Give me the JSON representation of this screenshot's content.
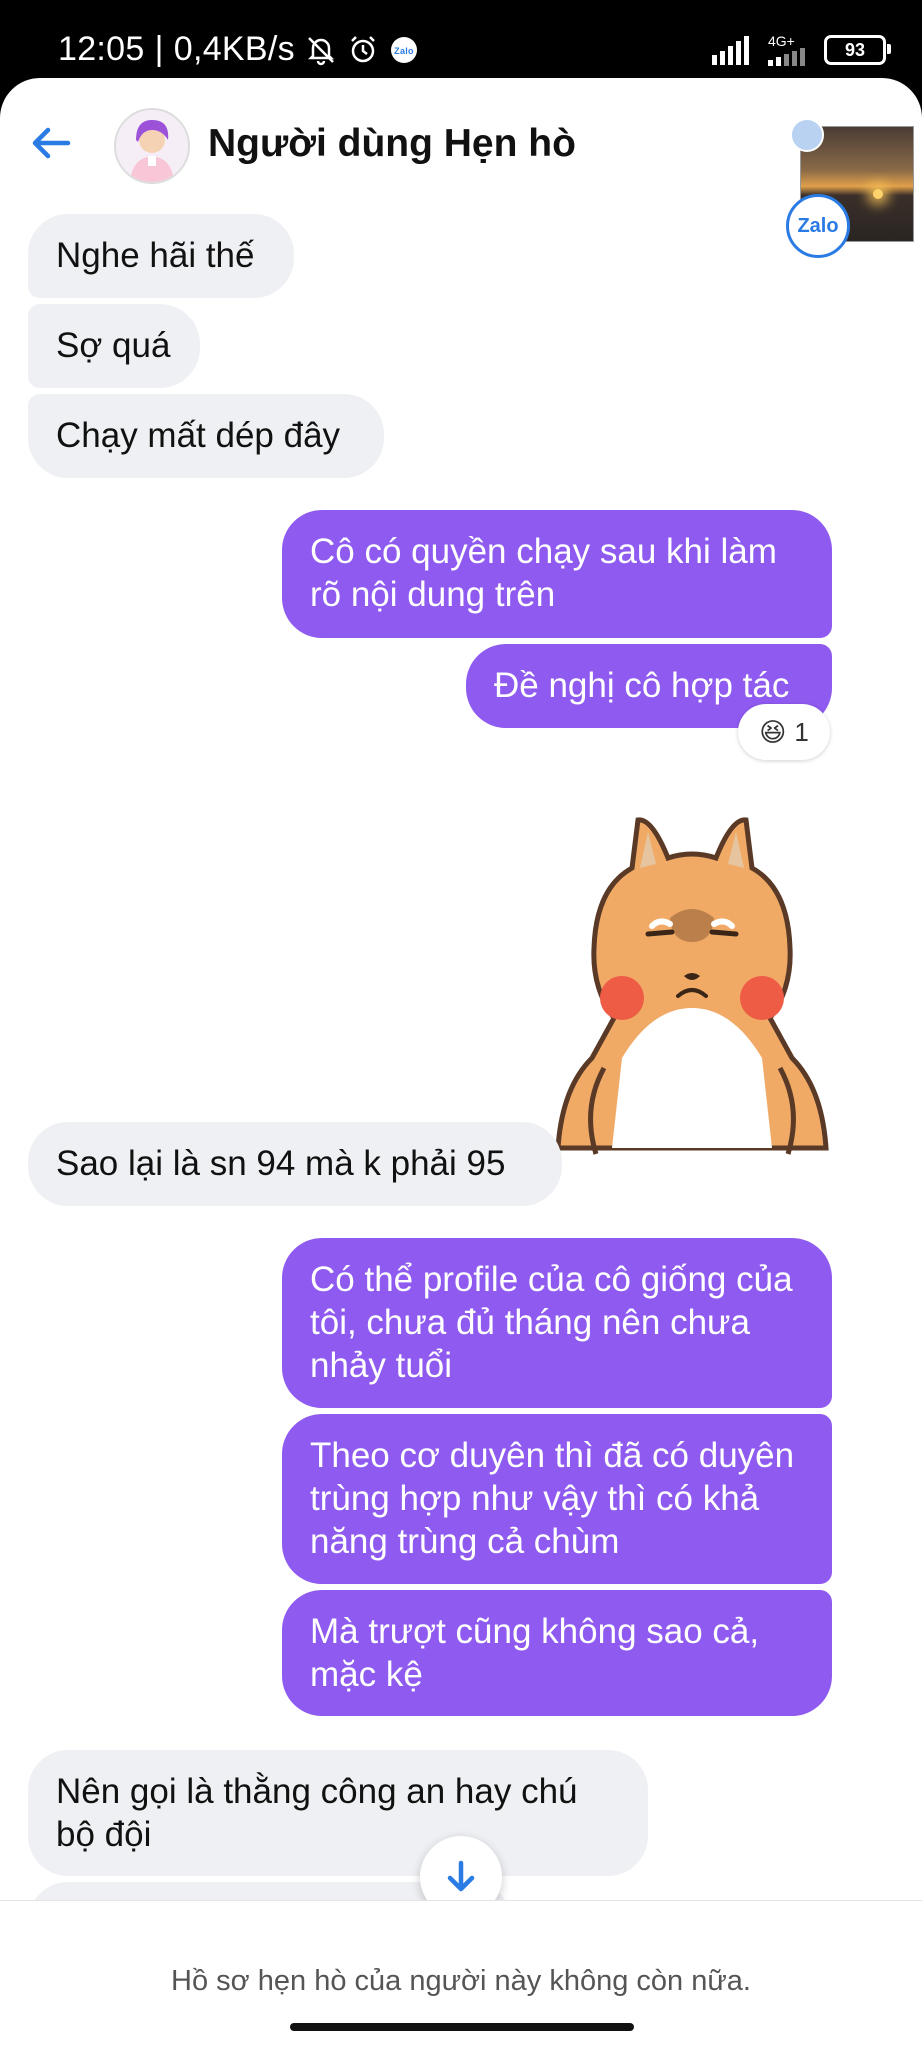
{
  "status_bar": {
    "time": "12:05",
    "net_speed": "0,4KB/s",
    "network_label": "4G+",
    "battery": "93",
    "zalo_notif_label": "Zalo"
  },
  "header": {
    "title": "Người dùng Hẹn hò",
    "pip_badge": "Zalo"
  },
  "messages": [
    {
      "side": "in",
      "text": "Nghe hãi thế"
    },
    {
      "side": "in",
      "text": "Sợ quá"
    },
    {
      "side": "in",
      "text": "Chạy mất dép đây"
    },
    {
      "side": "out",
      "text": "Cô có quyền chạy sau khi làm rõ nội dung trên"
    },
    {
      "side": "out",
      "text": "Đề nghị cô hợp tác"
    },
    {
      "side": "in",
      "text": "Sao lại là sn 94 mà k phải 95"
    },
    {
      "side": "out",
      "text": "Có thể profile của cô giống của tôi, chưa đủ tháng nên chưa nhảy tuổi"
    },
    {
      "side": "out",
      "text": "Theo cơ duyên thì đã có duyên trùng hợp như vậy thì có khả năng trùng cả chùm"
    },
    {
      "side": "out",
      "text": "Mà trượt cũng không sao cả, mặc kệ"
    },
    {
      "side": "in",
      "text": "Nên gọi là thằng công an hay chú bộ đội"
    }
  ],
  "reaction": {
    "emoji": "😆",
    "count": "1"
  },
  "footer": {
    "notice": "Hồ sơ hẹn hò của người này không còn nữa."
  },
  "colors": {
    "outgoing": "#8f5af0",
    "incoming": "#eef0f3",
    "accent": "#2a7be4"
  }
}
